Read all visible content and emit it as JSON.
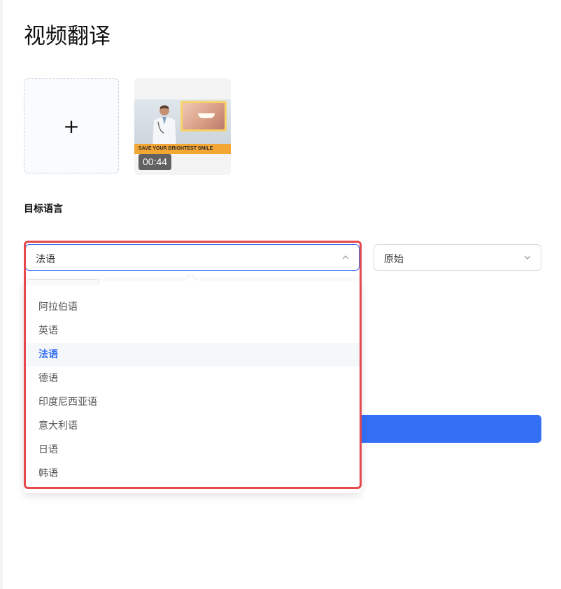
{
  "page": {
    "title": "视频翻译"
  },
  "upload": {
    "plus": "+"
  },
  "video": {
    "banner_text": "SAVE YOUR BRIGHTEST SMILE",
    "duration": "00:44"
  },
  "target_language": {
    "label": "目标语言",
    "selected": "法语",
    "options": [
      "阿拉伯语",
      "英语",
      "法语",
      "德语",
      "印度尼西亚语",
      "意大利语",
      "日语",
      "韩语"
    ]
  },
  "voice_select": {
    "value": "原始"
  },
  "colors": {
    "accent": "#3470f5",
    "highlight": "#e5484d"
  },
  "icons": {
    "lang_select": "chevron-up-icon",
    "voice_select": "chevron-down-icon",
    "upload": "plus-icon"
  }
}
